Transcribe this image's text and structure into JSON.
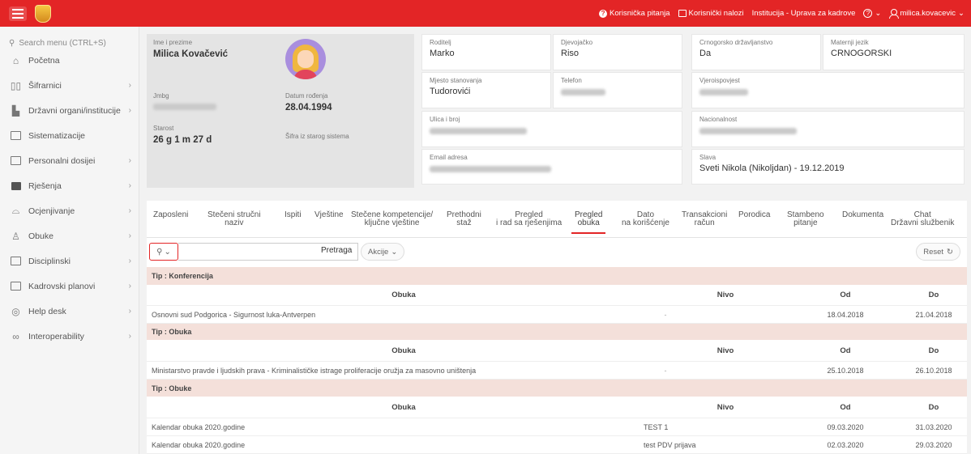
{
  "header": {
    "links": [
      "Korisnička pitanja",
      "Korisnički nalozi",
      "Institucija - Uprava za kadrove"
    ],
    "help_icon": "question-circle-icon",
    "user": "milica.kovacevic"
  },
  "sidebar": {
    "search_placeholder": "Search menu (CTRL+S)",
    "items": [
      {
        "label": "Početna",
        "icon": "home-icon"
      },
      {
        "label": "Šifrarnici",
        "icon": "book-icon"
      },
      {
        "label": "Državni organi/institucije",
        "icon": "building-icon"
      },
      {
        "label": "Sistematizacije",
        "icon": "grid-icon"
      },
      {
        "label": "Personalni dosijei",
        "icon": "id-card-icon"
      },
      {
        "label": "Rješenja",
        "icon": "folder-icon"
      },
      {
        "label": "Ocjenjivanje",
        "icon": "rating-icon"
      },
      {
        "label": "Obuke",
        "icon": "users-icon"
      },
      {
        "label": "Disciplinski",
        "icon": "document-icon"
      },
      {
        "label": "Kadrovski planovi",
        "icon": "plan-icon"
      },
      {
        "label": "Help desk",
        "icon": "helpdesk-icon"
      },
      {
        "label": "Interoperability",
        "icon": "link-icon"
      }
    ]
  },
  "profile": {
    "name_label": "Ime i prezime",
    "name": "Milica Kovačević",
    "jmbg_label": "Jmbg",
    "dob_label": "Datum rođenja",
    "dob": "28.04.1994",
    "age_label": "Starost",
    "age": "26 g 1 m 27 d",
    "old_code_label": "Šifra iz starog sistema"
  },
  "info": {
    "roditelj_label": "Roditelj",
    "roditelj": "Marko",
    "djevojacko_label": "Djevojačko",
    "djevojacko": "Riso",
    "drzavljanstvo_label": "Crnogorsko državljanstvo",
    "drzavljanstvo": "Da",
    "jezik_label": "Maternji jezik",
    "jezik": "CRNOGORSKI",
    "mjesto_label": "Mjesto stanovanja",
    "mjesto": "Tudorovići",
    "telefon_label": "Telefon",
    "vjeroispovjest_label": "Vjeroispovjest",
    "ulica_label": "Ulica i broj",
    "nacionalnost_label": "Nacionalnost",
    "email_label": "Email adresa",
    "slava_label": "Slava",
    "slava": "Sveti Nikola (Nikoljdan) - 19.12.2019"
  },
  "tabs": [
    {
      "l1": "Zaposleni",
      "l2": ""
    },
    {
      "l1": "Stečeni stručni",
      "l2": "naziv"
    },
    {
      "l1": "Ispiti",
      "l2": ""
    },
    {
      "l1": "Vještine",
      "l2": ""
    },
    {
      "l1": "Stečene kompetencije/",
      "l2": "ključne vještine"
    },
    {
      "l1": "Prethodni",
      "l2": "staž"
    },
    {
      "l1": "Pregled",
      "l2": "i rad sa rješenjima"
    },
    {
      "l1": "Pregled",
      "l2": "obuka"
    },
    {
      "l1": "Dato",
      "l2": "na korišćenje"
    },
    {
      "l1": "Transakcioni",
      "l2": "račun"
    },
    {
      "l1": "Porodica",
      "l2": ""
    },
    {
      "l1": "Stambeno",
      "l2": "pitanje"
    },
    {
      "l1": "Dokumenta",
      "l2": ""
    },
    {
      "l1": "Chat",
      "l2": "Državni službenik"
    }
  ],
  "active_tab": "Pregled obuka",
  "toolbar": {
    "search_button": "Pretraga",
    "actions": "Akcije",
    "reset": "Reset"
  },
  "columns": {
    "obuka": "Obuka",
    "nivo": "Nivo",
    "od": "Od",
    "do": "Do"
  },
  "groups": [
    {
      "title": "Tip : Konferencija",
      "rows": [
        {
          "obuka": "Osnovni sud Podgorica - Sigurnost luka-Antverpen",
          "nivo": "-",
          "od": "18.04.2018",
          "do": "21.04.2018"
        }
      ]
    },
    {
      "title": "Tip : Obuka",
      "rows": [
        {
          "obuka": "Ministarstvo pravde i ljudskih prava - Kriminalističke istrage proliferacije oružja za masovno uništenja",
          "nivo": "-",
          "od": "25.10.2018",
          "do": "26.10.2018"
        }
      ]
    },
    {
      "title": "Tip : Obuke",
      "rows": [
        {
          "obuka": "Kalendar obuka 2020.godine",
          "nivo": "TEST 1",
          "od": "09.03.2020",
          "do": "31.03.2020"
        },
        {
          "obuka": "Kalendar obuka 2020.godine",
          "nivo": "test PDV prijava",
          "od": "02.03.2020",
          "do": "29.03.2020"
        }
      ]
    }
  ]
}
